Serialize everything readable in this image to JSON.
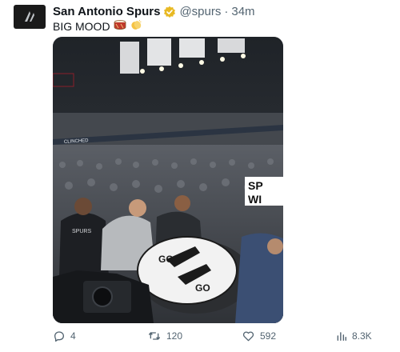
{
  "tweet": {
    "author": {
      "name": "San Antonio Spurs",
      "handle": "@spurs",
      "time": "34m",
      "separator": "·"
    },
    "text": "BIG MOOD",
    "text_emojis": [
      "drum-emoji",
      "clapping-hands-emoji"
    ],
    "media": {
      "description_words": {
        "banner_left": "SP",
        "banner_left_2": "WI",
        "drum_text_top": "GO",
        "drum_text_bottom": "GO",
        "ribbon_text": "CLINCHED",
        "jersey_text": "SPURS"
      }
    },
    "stats": {
      "replies": "4",
      "retweets": "120",
      "likes": "592",
      "views": "8.3K"
    }
  },
  "colors": {
    "verified_badge": "#e8b923",
    "icon_gray": "#536471",
    "drum_red": "#c0392b",
    "clap_yellow": "#f5c242"
  }
}
